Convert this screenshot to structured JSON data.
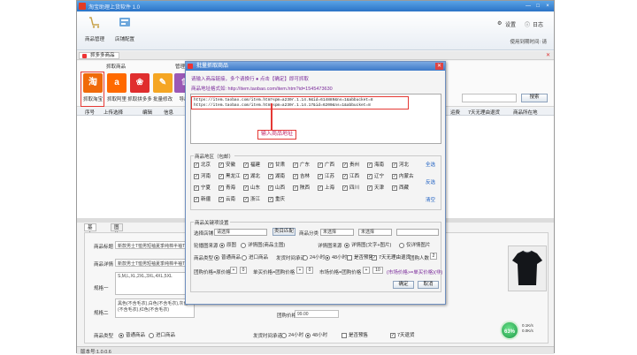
{
  "app": {
    "title": "淘宝助理上货软件 1.0",
    "window_controls": [
      "—",
      "□",
      "×"
    ]
  },
  "toolbar": {
    "items": [
      {
        "label": "商品管理",
        "icon": "cart-icon"
      },
      {
        "label": "店铺配置",
        "icon": "shop-config-icon"
      }
    ],
    "settings_label": "设置",
    "log_label": "日志",
    "reg_info": "使用到期时间: 请"
  },
  "doc_tab": {
    "label": "抓多多商品"
  },
  "sources": {
    "tab_labels": [
      "抓取商品",
      "管理"
    ],
    "items": [
      {
        "label": "抓取淘宝",
        "glyph": "淘",
        "color": "#f06a0a"
      },
      {
        "label": "抓取阿里",
        "glyph": "a",
        "color": "#ff6a00"
      },
      {
        "label": "抓取拼多多",
        "glyph": "❀",
        "color": "#e02e2e"
      },
      {
        "label": "批量修改",
        "glyph": "✎",
        "color": "#f5a623"
      },
      {
        "label": "导出",
        "glyph": "⇧",
        "color": "#9b59b6"
      }
    ],
    "search_btn": "搜索"
  },
  "grid": {
    "left_headers": [
      "序号",
      "上传选择",
      "编辑",
      "信息"
    ],
    "right_headers": [
      "运费",
      "7天无理由退货",
      "商品所在地"
    ]
  },
  "detail": {
    "tabs": [
      "基本信息",
      "图片信息"
    ],
    "title_label": "商品标题",
    "title_value": "新款男士T恤男短袖夏季纯棉半袖T恤男装上衣",
    "detail_label": "商品详情",
    "detail_value": "新款男士T恤男短袖夏季纯棉半袖T恤男装上衣",
    "attr1_label": "规格一",
    "attr1_value": "S,M,L,XL,2XL,3XL,4XL,5XL",
    "attr2_label": "规格二",
    "attr2_value": "黑色(不含毛衣),白色(不含毛衣),灰色(不含毛衣),红色(不含毛衣)",
    "price_label": "团购价格",
    "price_value": "99.00",
    "type_label": "商品类型",
    "type_options": [
      "普通商品",
      "进口商品"
    ],
    "ship_label": "发货时间承诺",
    "ship_options": [
      "24小时",
      "48小时"
    ],
    "presale_label": "是否预售",
    "return_label": "7天退货"
  },
  "status": {
    "gauge_value": "63%",
    "speed_up": "0.1K/s",
    "speed_down": "0.0K/s",
    "bar_text": "版本号:1.0.0.6"
  },
  "dialog": {
    "title": "批量抓取商品",
    "instruction": "请输入商品链接，多个请换行  ● 点击【确定】即可抓取",
    "example": "商品地址格式如: http://item.taobao.com/item.htm?id=1545473630",
    "urls": [
      "https://item.taobao.com/item.htm?spm=a230r.1.14.9&id=614889&ns=1&abbucket=8",
      "https://item.taobao.com/item.htm?spm=a230r.1.14.17&id=6200&ns=1&abbucket=8"
    ],
    "url_hint": "输入商品地址",
    "region_title": "商品地区（包邮）",
    "regions": [
      [
        "北京",
        "安徽",
        "福建",
        "甘肃",
        "广东",
        "广西",
        "贵州",
        "海南",
        "河北"
      ],
      [
        "河南",
        "黑龙江",
        "湖北",
        "湖南",
        "吉林",
        "江苏",
        "江西",
        "辽宁",
        "内蒙古"
      ],
      [
        "宁夏",
        "青海",
        "山东",
        "山西",
        "陕西",
        "上海",
        "四川",
        "天津",
        "西藏"
      ],
      [
        "新疆",
        "云南",
        "浙江",
        "重庆"
      ]
    ],
    "region_links": [
      "全选",
      "反选",
      "清空"
    ],
    "settings_title": "商品关键项设置",
    "category_label": "选择店铺",
    "category_placeholder": "请选择",
    "confirm_cat_btn": "类目匹配",
    "goods_class_label": "商品分类",
    "goods_class_value": "未选择",
    "unselected": "未选择",
    "image_label": "轮播图来源",
    "image_options": [
      "原图",
      "详情图(商品主图)"
    ],
    "detail_src_label": "详情图来源",
    "detail_src_options": [
      "详情图(文字+图片)",
      "仅详情图片"
    ],
    "type_label": "商品类型",
    "type_options": [
      "普通商品",
      "进口商品"
    ],
    "ship_label": "发货时间承诺",
    "ship_options": [
      "24小时",
      "48小时"
    ],
    "presale_label": "是否预售",
    "return_label": "7天无理由退货",
    "group_count_label": "团购人数",
    "group_count_value": "2",
    "price_row_label1": "团购价格=原价格",
    "price_row_label2": "单买价格=团购价格",
    "price_row_label3": "市场价格=团购价格",
    "price_row_op": "+",
    "price_row_val": "0",
    "price_row_val3": "10",
    "note": "(市场价格>=单买价格)(非)",
    "ok_btn": "确定",
    "cancel_btn": "取消"
  }
}
